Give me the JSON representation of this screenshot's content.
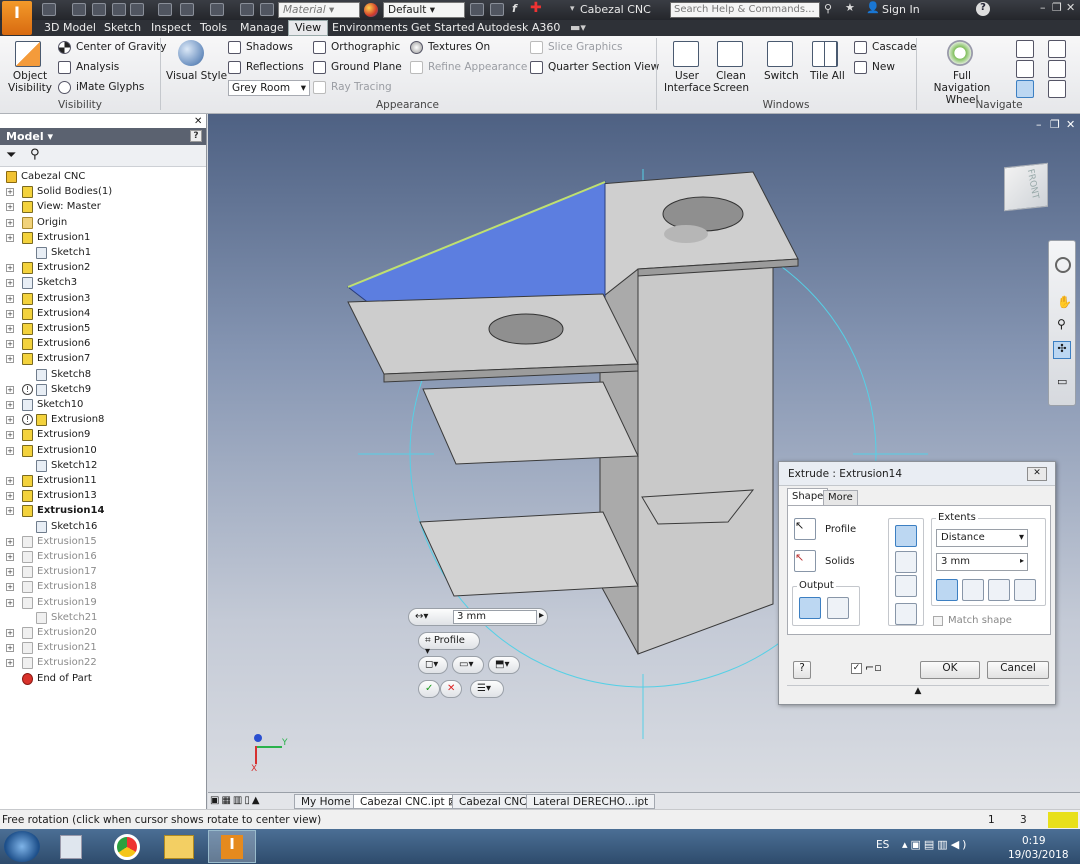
{
  "titlebar": {
    "material_label": "Material",
    "appearance_label": "Default",
    "document_title": "Cabezal CNC",
    "search_placeholder": "Search Help & Commands...",
    "sign_in": "Sign In"
  },
  "ribbon_tabs": [
    "3D Model",
    "Sketch",
    "Inspect",
    "Tools",
    "Manage",
    "View",
    "Environments",
    "Get Started",
    "Autodesk A360"
  ],
  "active_tab": "View",
  "ribbon": {
    "visibility": {
      "object_visibility": "Object Visibility",
      "center_of_gravity": "Center of Gravity",
      "analysis": "Analysis",
      "imate_glyphs": "iMate Glyphs",
      "label": "Visibility"
    },
    "appearance": {
      "visual_style": "Visual Style",
      "shadows": "Shadows",
      "reflections": "Reflections",
      "grey_room": "Grey Room",
      "orthographic": "Orthographic",
      "ground_plane": "Ground Plane",
      "ray_tracing": "Ray Tracing",
      "textures_on": "Textures On",
      "refine_appearance": "Refine Appearance",
      "slice_graphics": "Slice Graphics",
      "quarter_section_view": "Quarter Section View",
      "label": "Appearance"
    },
    "windows": {
      "user_interface": "User Interface",
      "clean_screen": "Clean Screen",
      "switch": "Switch",
      "tile_all": "Tile All",
      "cascade": "Cascade",
      "new": "New",
      "label": "Windows"
    },
    "navigate": {
      "full_navigation_wheel": "Full Navigation Wheel",
      "label": "Navigate"
    }
  },
  "browser": {
    "header": "Model ▾",
    "tree": [
      {
        "label": "Cabezal CNC",
        "level": 0,
        "icon": "part-icon",
        "state": "normal"
      },
      {
        "label": "Solid Bodies(1)",
        "level": 1,
        "icon": "solid-bodies-icon",
        "state": "normal"
      },
      {
        "label": "View: Master",
        "level": 1,
        "icon": "view-icon",
        "state": "normal"
      },
      {
        "label": "Origin",
        "level": 1,
        "icon": "folder-icon",
        "state": "normal"
      },
      {
        "label": "Extrusion1",
        "level": 1,
        "icon": "extrusion-icon",
        "state": "normal"
      },
      {
        "label": "Sketch1",
        "level": 2,
        "icon": "sketch-icon",
        "state": "normal"
      },
      {
        "label": "Extrusion2",
        "level": 1,
        "icon": "extrusion-icon",
        "state": "normal"
      },
      {
        "label": "Sketch3",
        "level": 1,
        "icon": "sketch-icon",
        "state": "normal"
      },
      {
        "label": "Extrusion3",
        "level": 1,
        "icon": "extrusion-icon",
        "state": "normal"
      },
      {
        "label": "Extrusion4",
        "level": 1,
        "icon": "extrusion-icon",
        "state": "normal"
      },
      {
        "label": "Extrusion5",
        "level": 1,
        "icon": "extrusion-icon",
        "state": "normal"
      },
      {
        "label": "Extrusion6",
        "level": 1,
        "icon": "extrusion-icon",
        "state": "normal"
      },
      {
        "label": "Extrusion7",
        "level": 1,
        "icon": "extrusion-icon",
        "state": "normal"
      },
      {
        "label": "Sketch8",
        "level": 2,
        "icon": "sketch-icon",
        "state": "normal"
      },
      {
        "label": "Sketch9",
        "level": 1,
        "icon": "sketch-icon",
        "state": "warning"
      },
      {
        "label": "Sketch10",
        "level": 1,
        "icon": "sketch-icon",
        "state": "normal"
      },
      {
        "label": "Extrusion8",
        "level": 1,
        "icon": "extrusion-icon",
        "state": "warning"
      },
      {
        "label": "Extrusion9",
        "level": 1,
        "icon": "extrusion-icon",
        "state": "normal"
      },
      {
        "label": "Extrusion10",
        "level": 1,
        "icon": "extrusion-icon",
        "state": "normal"
      },
      {
        "label": "Sketch12",
        "level": 2,
        "icon": "sketch-icon",
        "state": "normal"
      },
      {
        "label": "Extrusion11",
        "level": 1,
        "icon": "extrusion-icon",
        "state": "normal"
      },
      {
        "label": "Extrusion13",
        "level": 1,
        "icon": "extrusion-icon",
        "state": "normal"
      },
      {
        "label": "Extrusion14",
        "level": 1,
        "icon": "extrusion-icon",
        "state": "active"
      },
      {
        "label": "Sketch16",
        "level": 2,
        "icon": "sketch-icon",
        "state": "normal"
      },
      {
        "label": "Extrusion15",
        "level": 1,
        "icon": "extrusion-icon",
        "state": "dim"
      },
      {
        "label": "Extrusion16",
        "level": 1,
        "icon": "extrusion-icon",
        "state": "dim"
      },
      {
        "label": "Extrusion17",
        "level": 1,
        "icon": "extrusion-icon",
        "state": "dim"
      },
      {
        "label": "Extrusion18",
        "level": 1,
        "icon": "extrusion-icon",
        "state": "dim"
      },
      {
        "label": "Extrusion19",
        "level": 1,
        "icon": "extrusion-icon",
        "state": "dim"
      },
      {
        "label": "Sketch21",
        "level": 2,
        "icon": "sketch-icon",
        "state": "dim"
      },
      {
        "label": "Extrusion20",
        "level": 1,
        "icon": "extrusion-icon",
        "state": "dim"
      },
      {
        "label": "Extrusion21",
        "level": 1,
        "icon": "extrusion-icon",
        "state": "dim"
      },
      {
        "label": "Extrusion22",
        "level": 1,
        "icon": "extrusion-icon",
        "state": "dim"
      },
      {
        "label": "End of Part",
        "level": 1,
        "icon": "end-of-part-icon",
        "state": "normal"
      }
    ]
  },
  "viewcube": {
    "face_label": "FRONT"
  },
  "triad": {
    "y": "Y",
    "x": "X"
  },
  "mini_toolbar": {
    "distance": "3 mm",
    "profile": "Profile"
  },
  "dialog": {
    "title": "Extrude : Extrusion14",
    "tabs": [
      "Shape",
      "More"
    ],
    "profile": "Profile",
    "solids": "Solids",
    "output": "Output",
    "extents": "Extents",
    "extents_type": "Distance",
    "distance": "3 mm",
    "match_shape": "Match shape",
    "ok": "OK",
    "cancel": "Cancel"
  },
  "doc_tabs": [
    "My Home",
    "Cabezal CNC.ipt",
    "Cabezal CNC",
    "Lateral DERECHO...ipt"
  ],
  "active_doc_tab": "Cabezal CNC.ipt",
  "status": {
    "text": "Free rotation (click when cursor shows rotate to center view)",
    "count1": "1",
    "count2": "3"
  },
  "taskbar": {
    "language": "ES",
    "time": "0:19",
    "date": "19/03/2018"
  },
  "colors": {
    "accent": "#2d6bb3",
    "selected_face": "#5c7ee0",
    "dialog_active": "#bcd7f2",
    "viewport_top": "#4e6183"
  }
}
